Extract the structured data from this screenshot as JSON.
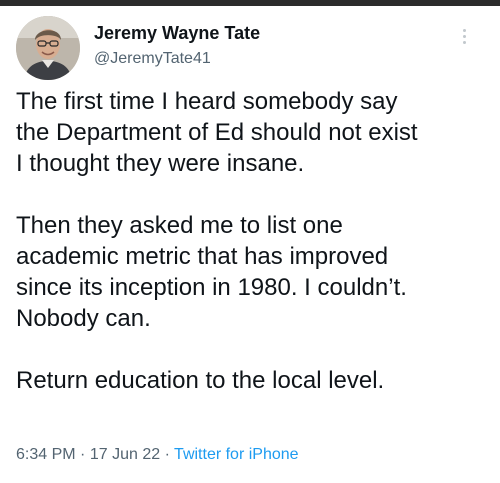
{
  "author": {
    "display_name": "Jeremy Wayne Tate",
    "handle": "@JeremyTate41",
    "avatar_icon": "profile-photo"
  },
  "tweet": {
    "paragraphs": [
      "The first time I heard somebody say\nthe Department of Ed should not exist\nI thought they were insane.",
      "Then they asked me to list one\nacademic metric that has improved\nsince its inception in 1980. I couldn’t.\nNobody can.",
      "Return education to the local level."
    ]
  },
  "meta": {
    "time": "6:34 PM",
    "separator": "·",
    "date": "17 Jun 22",
    "source": "Twitter for iPhone"
  },
  "colors": {
    "text": "#0f1419",
    "secondary": "#536471",
    "link": "#1d9bf0"
  }
}
